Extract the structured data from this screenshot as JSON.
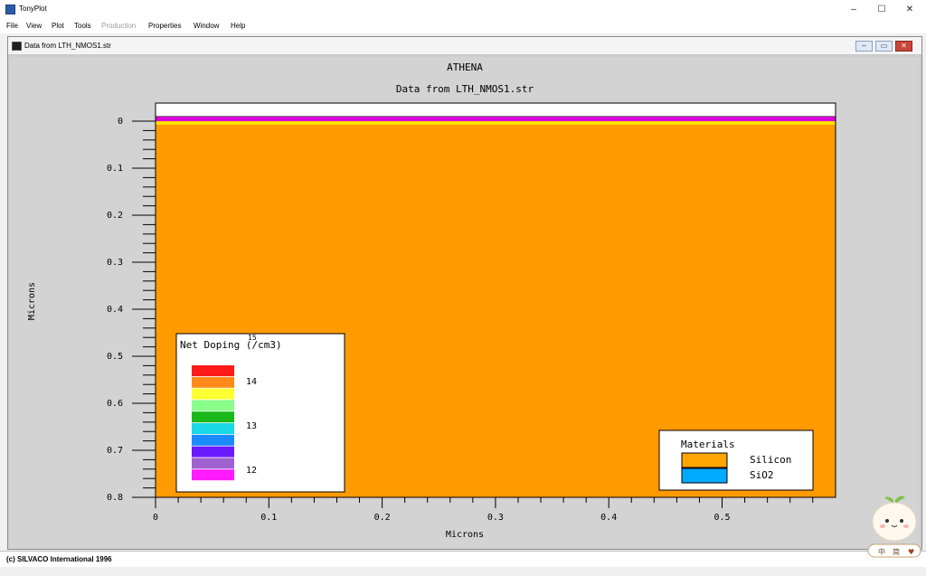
{
  "window": {
    "title": "TonyPlot",
    "minimize": "–",
    "maximize": "☐",
    "close": "✕"
  },
  "menu": [
    "File",
    "View",
    "Plot",
    "Tools",
    "Production",
    "Properties",
    "Window",
    "Help"
  ],
  "menu_disabled": [
    "Production"
  ],
  "document": {
    "title": "Data from LTH_NMOS1.str"
  },
  "plot": {
    "title": "ATHENA",
    "subtitle": "Data from LTH_NMOS1.str",
    "xlabel": "Microns",
    "ylabel": "Microns",
    "x_ticks": [
      "0",
      "0.1",
      "0.2",
      "0.3",
      "0.4",
      "0.5"
    ],
    "y_ticks": [
      "0",
      "0.1",
      "0.2",
      "0.3",
      "0.4",
      "0.5",
      "0.6",
      "0.7",
      "0.8"
    ],
    "region_colors": {
      "top_strip": "#ffffff",
      "sio2_layer": "#d800d8",
      "surface_band": "#ffe000",
      "silicon": "#ff9a00"
    }
  },
  "doping_legend": {
    "title": "Net Doping (/cm3)",
    "stray_label": "15",
    "labels": [
      "14",
      "13",
      "12"
    ],
    "swatches": [
      "#ff1a1a",
      "#ff8a1a",
      "#ffff33",
      "#8aff8a",
      "#1ab81a",
      "#1ad8e8",
      "#1a8aff",
      "#6a1aff",
      "#a060d0",
      "#ff1aff"
    ]
  },
  "materials_legend": {
    "title": "Materials",
    "items": [
      {
        "label": "Silicon",
        "color": "#ffa500"
      },
      {
        "label": "SiO2",
        "color": "#00aaff"
      }
    ]
  },
  "status": {
    "text": "(c) SILVACO International 1996"
  },
  "mascot": {
    "chars": [
      "中",
      "简",
      "♥"
    ]
  }
}
